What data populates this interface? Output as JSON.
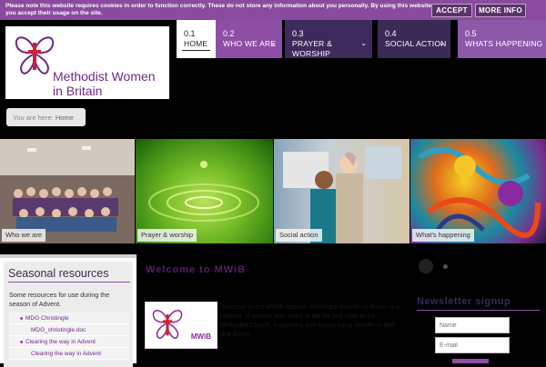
{
  "cookie": {
    "message": "Please note this website requires cookies in order to function correctly. These do not store any information about you personally. By using this website, you accept their usage on the site.",
    "accept_label": "ACCEPT",
    "more_label": "MORE INFO"
  },
  "logo": {
    "line1": "Methodist Women",
    "line2": "in Britain"
  },
  "nav": [
    {
      "num": "0.1",
      "label": "HOME"
    },
    {
      "num": "0.2",
      "label": "WHO WE ARE"
    },
    {
      "num": "0.3",
      "label": "PRAYER & WORSHIP"
    },
    {
      "num": "0.4",
      "label": "SOCIAL ACTION"
    },
    {
      "num": "0.5",
      "label": "WHATS HAPPENING"
    }
  ],
  "breadcrumb": {
    "prefix": "You are here:",
    "home": "Home"
  },
  "panels": [
    {
      "caption": "Who we are"
    },
    {
      "caption": "Prayer & worship"
    },
    {
      "caption": "Social action"
    },
    {
      "caption": "What's happening"
    }
  ],
  "sidebar": {
    "title": "Seasonal resources",
    "description": "Some resources for use during the season of Advent.",
    "items": [
      {
        "label": "MDG Christingle"
      },
      {
        "label": "MDG_christingle.doc"
      },
      {
        "label": "Clearing the way in Advent"
      },
      {
        "label": "Clearing the way in Advent"
      }
    ]
  },
  "main": {
    "welcome": "Welcome to MWiB",
    "mwib_label": "MWiB",
    "intro": "Welcome to the MWiB website. Methodist Women in Britain is a network of women who share in the life and work of the Methodist Church, supporting and encouraging women in faith and action."
  },
  "signup": {
    "title": "Newsletter signup",
    "name_placeholder": "Name",
    "email_placeholder": "E-mail"
  }
}
